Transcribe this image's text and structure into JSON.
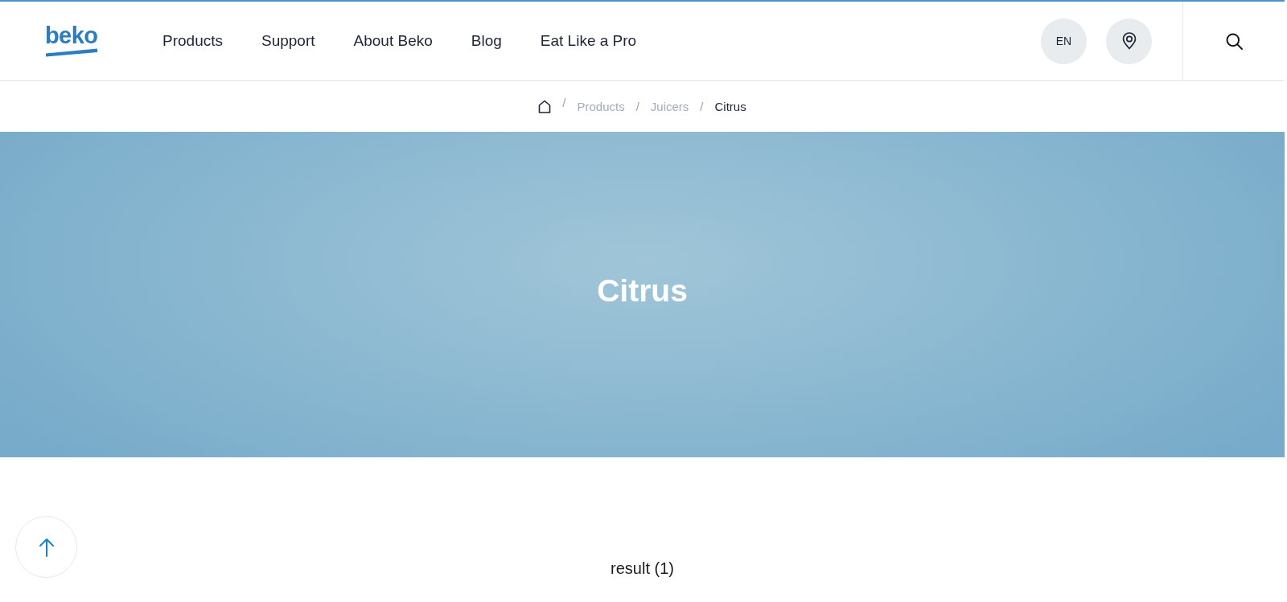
{
  "header": {
    "logo": "beko",
    "nav": [
      {
        "label": "Products"
      },
      {
        "label": "Support"
      },
      {
        "label": "About Beko"
      },
      {
        "label": "Blog"
      },
      {
        "label": "Eat Like a Pro"
      }
    ],
    "language": "EN"
  },
  "breadcrumb": [
    {
      "kind": "home",
      "separator": "/"
    },
    {
      "kind": "link",
      "label": "Products",
      "separator": "/"
    },
    {
      "kind": "link",
      "label": "Juicers",
      "separator": "/"
    },
    {
      "kind": "current",
      "label": "Citrus"
    }
  ],
  "hero": {
    "title": "Citrus"
  },
  "results": {
    "count_label": "result (1)"
  }
}
